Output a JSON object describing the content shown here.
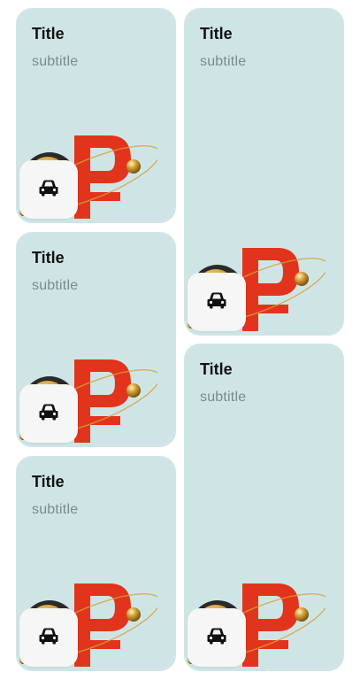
{
  "cards": [
    {
      "title": "Title",
      "subtitle": "subtitle",
      "icon": "car-icon",
      "illustration": "ruble-coin-illustration"
    },
    {
      "title": "Title",
      "subtitle": "subtitle",
      "icon": "car-icon",
      "illustration": "ruble-coin-illustration"
    },
    {
      "title": "Title",
      "subtitle": "subtitle",
      "icon": "car-icon",
      "illustration": "ruble-coin-illustration"
    },
    {
      "title": "Title",
      "subtitle": "subtitle",
      "icon": "car-icon",
      "illustration": "ruble-coin-illustration"
    },
    {
      "title": "Title",
      "subtitle": "subtitle",
      "icon": "car-icon",
      "illustration": "ruble-coin-illustration"
    }
  ],
  "colors": {
    "card_background": "#cfe5e5",
    "ruble_red": "#e2341d",
    "badge_background": "#f6f6f6",
    "gold": "#d4a13a"
  }
}
